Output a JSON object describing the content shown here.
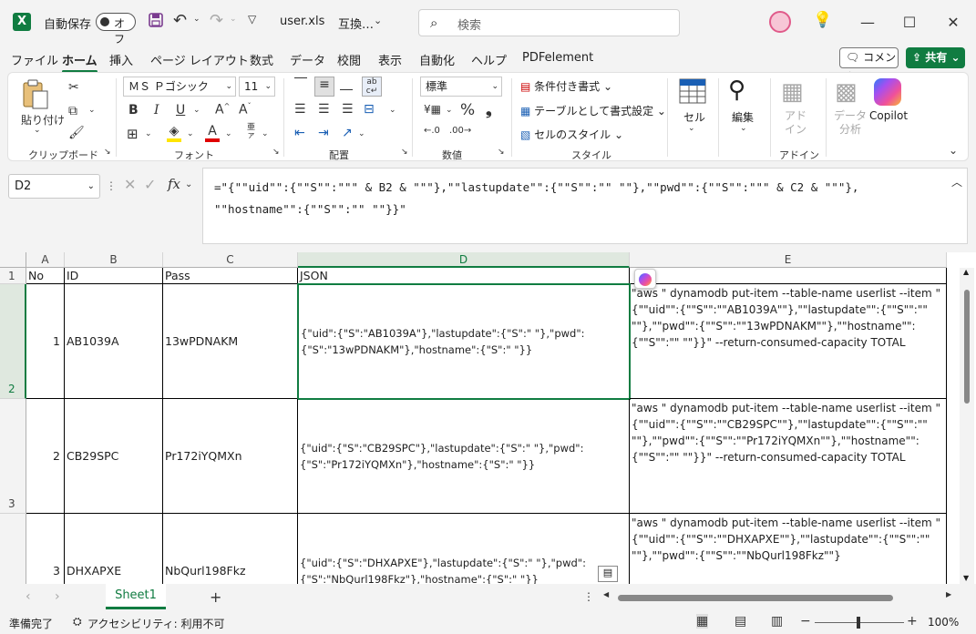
{
  "titlebar": {
    "autosave_label": "自動保存",
    "autosave_state": "オフ",
    "filename": "user.xls",
    "compat": "互換…",
    "search_placeholder": "検索"
  },
  "menu": [
    "ファイル",
    "ホーム",
    "挿入",
    "ページ レイアウト",
    "数式",
    "データ",
    "校閲",
    "表示",
    "自動化",
    "ヘルプ",
    "PDFelement"
  ],
  "active_tab": "ホーム",
  "comment_label": "コメント",
  "share_label": "共有",
  "ribbon": {
    "clipboard": {
      "paste": "貼り付け",
      "label": "クリップボード"
    },
    "font": {
      "name": "ＭＳ Ｐゴシック",
      "size": "11",
      "label": "フォント"
    },
    "alignment": {
      "label": "配置"
    },
    "number": {
      "format": "標準",
      "label": "数値"
    },
    "styles": {
      "cond": "条件付き書式",
      "table": "テーブルとして書式設定",
      "cell": "セルのスタイル",
      "label": "スタイル"
    },
    "cells": {
      "label": "セル"
    },
    "editing": {
      "label": "編集"
    },
    "addin": {
      "btn": "アド\nイン",
      "label": "アドイン"
    },
    "data_analysis": "データ\n分析",
    "copilot": "Copilot"
  },
  "namebox": "D2",
  "formula": "=\"{\"\"uid\"\":{\"\"S\"\":\"\"\" & B2 & \"\"\"},\"\"lastupdate\"\":{\"\"S\"\":\"\" \"\"},\"\"pwd\"\":{\"\"S\"\":\"\"\" & C2 & \"\"\"},\n\"\"hostname\"\":{\"\"S\"\":\"\" \"\"}}\"",
  "columns": [
    "A",
    "B",
    "C",
    "D",
    "E"
  ],
  "header_row": {
    "no": "No",
    "id": "ID",
    "pass": "Pass",
    "json": "JSON",
    "e": ""
  },
  "rows": [
    {
      "rownum": "2",
      "no": "1",
      "id": "AB1039A",
      "pass": "13wPDNAKM",
      "json": "{\"uid\":{\"S\":\"AB1039A\"},\"lastupdate\":{\"S\":\" \"},\"pwd\":{\"S\":\"13wPDNAKM\"},\"hostname\":{\"S\":\" \"}}",
      "cmd": "\"aws \" dynamodb put-item --table-name userlist --item \"{\"\"uid\"\":{\"\"S\"\":\"\"AB1039A\"\"},\"\"lastupdate\"\":{\"\"S\"\":\"\" \"\"},\"\"pwd\"\":{\"\"S\"\":\"\"13wPDNAKM\"\"},\"\"hostname\"\":{\"\"S\"\":\"\" \"\"}}\" --return-consumed-capacity TOTAL"
    },
    {
      "rownum": "3",
      "no": "2",
      "id": "CB29SPC",
      "pass": "Pr172iYQMXn",
      "json": "{\"uid\":{\"S\":\"CB29SPC\"},\"lastupdate\":{\"S\":\" \"},\"pwd\":{\"S\":\"Pr172iYQMXn\"},\"hostname\":{\"S\":\" \"}}",
      "cmd": "\"aws \" dynamodb put-item --table-name userlist --item \"{\"\"uid\"\":{\"\"S\"\":\"\"CB29SPC\"\"},\"\"lastupdate\"\":{\"\"S\"\":\"\" \"\"},\"\"pwd\"\":{\"\"S\"\":\"\"Pr172iYQMXn\"\"},\"\"hostname\"\":{\"\"S\"\":\"\" \"\"}}\" --return-consumed-capacity TOTAL"
    },
    {
      "rownum": "",
      "no": "3",
      "id": "DHXAPXE",
      "pass": "NbQurl198Fkz",
      "json": "{\"uid\":{\"S\":\"DHXAPXE\"},\"lastupdate\":{\"S\":\" \"},\"pwd\":{\"S\":\"NbQurl198Fkz\"},\"hostname\":{\"S\":\" \"}}",
      "cmd": "\"aws \" dynamodb put-item --table-name userlist --item \"{\"\"uid\"\":{\"\"S\"\":\"\"DHXAPXE\"\"},\"\"lastupdate\"\":{\"\"S\"\":\"\" \"\"},\"\"pwd\"\":{\"\"S\"\":\"\"NbQurl198Fkz\"\"}"
    }
  ],
  "sheet": "Sheet1",
  "status": {
    "ready": "準備完了",
    "accessibility": "アクセシビリティ: 利用不可",
    "zoom": "100%"
  },
  "colors": {
    "accent": "#107c41",
    "selection": "#dfe8df"
  }
}
